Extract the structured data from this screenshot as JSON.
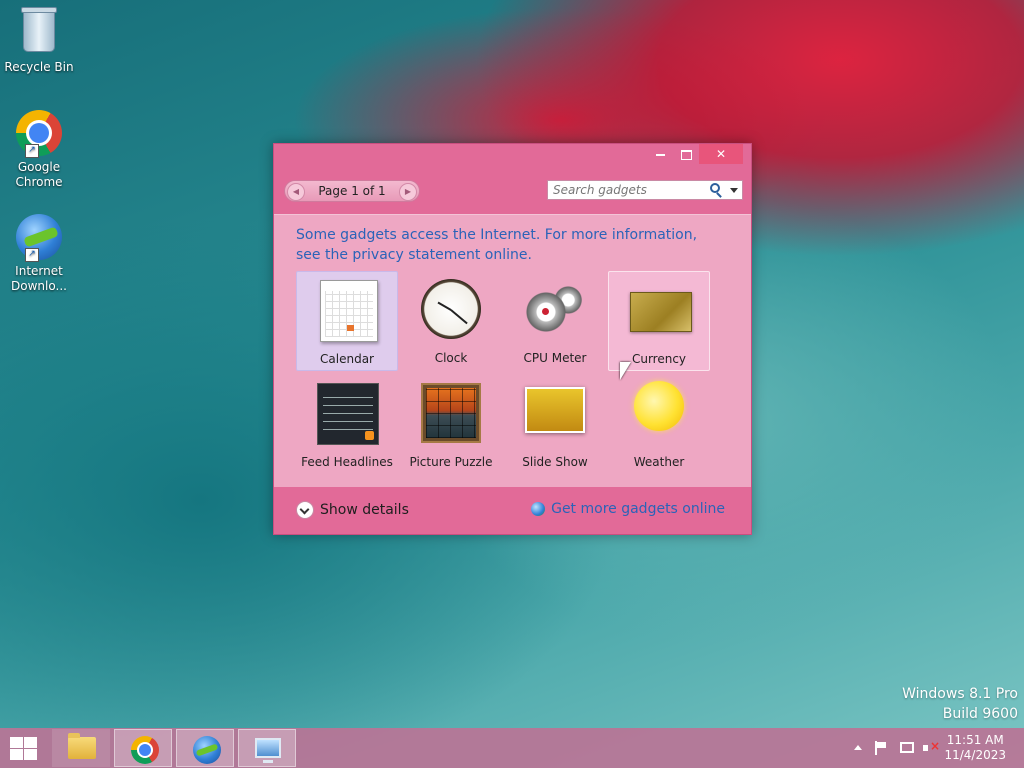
{
  "desktop": {
    "icons": [
      {
        "label": "Recycle Bin"
      },
      {
        "label": "Google Chrome"
      },
      {
        "label": "Internet Downlo..."
      }
    ],
    "watermark": {
      "line1": "Windows 8.1 Pro",
      "line2": "Build 9600"
    }
  },
  "gadget_window": {
    "pager_label": "Page 1 of 1",
    "search_placeholder": "Search gadgets",
    "notice": "Some gadgets access the Internet.  For more information, see the privacy statement online.",
    "gadgets": [
      {
        "name": "Calendar",
        "icon": "calendar-icon",
        "state": "selected"
      },
      {
        "name": "Clock",
        "icon": "clock-icon",
        "state": "normal"
      },
      {
        "name": "CPU Meter",
        "icon": "cpu-meter-icon",
        "state": "normal"
      },
      {
        "name": "Currency",
        "icon": "currency-icon",
        "state": "hover"
      },
      {
        "name": "Feed Headlines",
        "icon": "feed-headlines-icon",
        "state": "normal"
      },
      {
        "name": "Picture Puzzle",
        "icon": "picture-puzzle-icon",
        "state": "normal"
      },
      {
        "name": "Slide Show",
        "icon": "slide-show-icon",
        "state": "normal"
      },
      {
        "name": "Weather",
        "icon": "weather-icon",
        "state": "normal"
      }
    ],
    "show_details": "Show details",
    "get_more": "Get more gadgets online"
  },
  "taskbar": {
    "time": "11:51 AM",
    "date": "11/4/2023",
    "pinned": [
      "file-explorer",
      "google-chrome",
      "internet-download-manager",
      "desktop-gadgets"
    ]
  },
  "colors": {
    "window": "#e26a98",
    "content": "#eea7c3",
    "link": "#2b63b8"
  }
}
